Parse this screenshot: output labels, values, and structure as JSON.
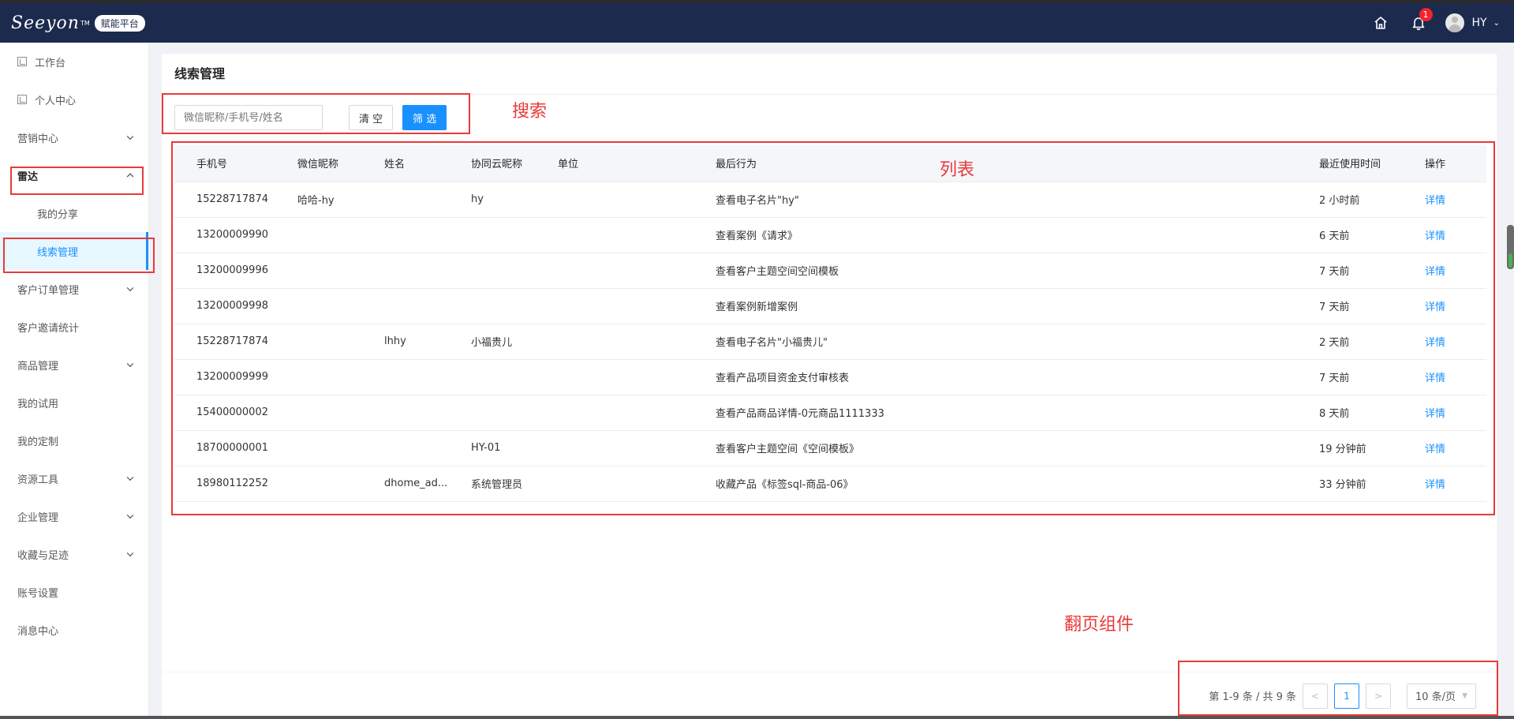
{
  "header": {
    "logo_text": "Seeyon",
    "logo_tm": "TM",
    "logo_badge": "赋能平台",
    "notification_count": "1",
    "user_name": "HY"
  },
  "sidebar": {
    "items": [
      {
        "label": "工作台"
      },
      {
        "label": "个人中心"
      },
      {
        "label": "营销中心"
      },
      {
        "label": "雷达"
      },
      {
        "label": "我的分享"
      },
      {
        "label": "线索管理"
      },
      {
        "label": "客户订单管理"
      },
      {
        "label": "客户邀请统计"
      },
      {
        "label": "商品管理"
      },
      {
        "label": "我的试用"
      },
      {
        "label": "我的定制"
      },
      {
        "label": "资源工具"
      },
      {
        "label": "企业管理"
      },
      {
        "label": "收藏与足迹"
      },
      {
        "label": "账号设置"
      },
      {
        "label": "消息中心"
      }
    ]
  },
  "page": {
    "title": "线索管理"
  },
  "search": {
    "placeholder": "微信昵称/手机号/姓名",
    "clear_label": "清 空",
    "filter_label": "筛 选"
  },
  "table": {
    "headers": [
      "手机号",
      "微信昵称",
      "姓名",
      "协同云昵称",
      "单位",
      "最后行为",
      "最近使用时间",
      "操作"
    ],
    "rows": [
      [
        "15228717874",
        "哈哈-hy",
        "",
        "hy",
        "",
        "查看电子名片\"hy\"",
        "2 小时前",
        "详情"
      ],
      [
        "13200009990",
        "",
        "",
        "",
        "",
        "查看案例《请求》",
        "6 天前",
        "详情"
      ],
      [
        "13200009996",
        "",
        "",
        "",
        "",
        "查看客户主题空间空间模板",
        "7 天前",
        "详情"
      ],
      [
        "13200009998",
        "",
        "",
        "",
        "",
        "查看案例新增案例",
        "7 天前",
        "详情"
      ],
      [
        "15228717874",
        "",
        "lhhy",
        "小福贵儿",
        "",
        "查看电子名片\"小福贵儿\"",
        "2 天前",
        "详情"
      ],
      [
        "13200009999",
        "",
        "",
        "",
        "",
        "查看产品项目资金支付审核表",
        "7 天前",
        "详情"
      ],
      [
        "15400000002",
        "",
        "",
        "",
        "",
        "查看产品商品详情-0元商品1111333",
        "8 天前",
        "详情"
      ],
      [
        "18700000001",
        "",
        "",
        "HY-01",
        "",
        "查看客户主题空间《空间模板》",
        "19 分钟前",
        "详情"
      ],
      [
        "18980112252",
        "",
        "dhome_ad...",
        "系统管理员",
        "",
        "收藏产品《标签sql-商品-06》",
        "33 分钟前",
        "详情"
      ]
    ]
  },
  "pagination": {
    "summary": "第 1-9 条 / 共 9 条",
    "prev": "<",
    "current": "1",
    "next": ">",
    "page_size": "10 条/页"
  },
  "annotations": {
    "search": "搜索",
    "list": "列表",
    "pager": "翻页组件"
  },
  "colors": {
    "topbar": "#1c2a4e",
    "accent": "#1890ff",
    "annotation": "#e83a3a"
  }
}
